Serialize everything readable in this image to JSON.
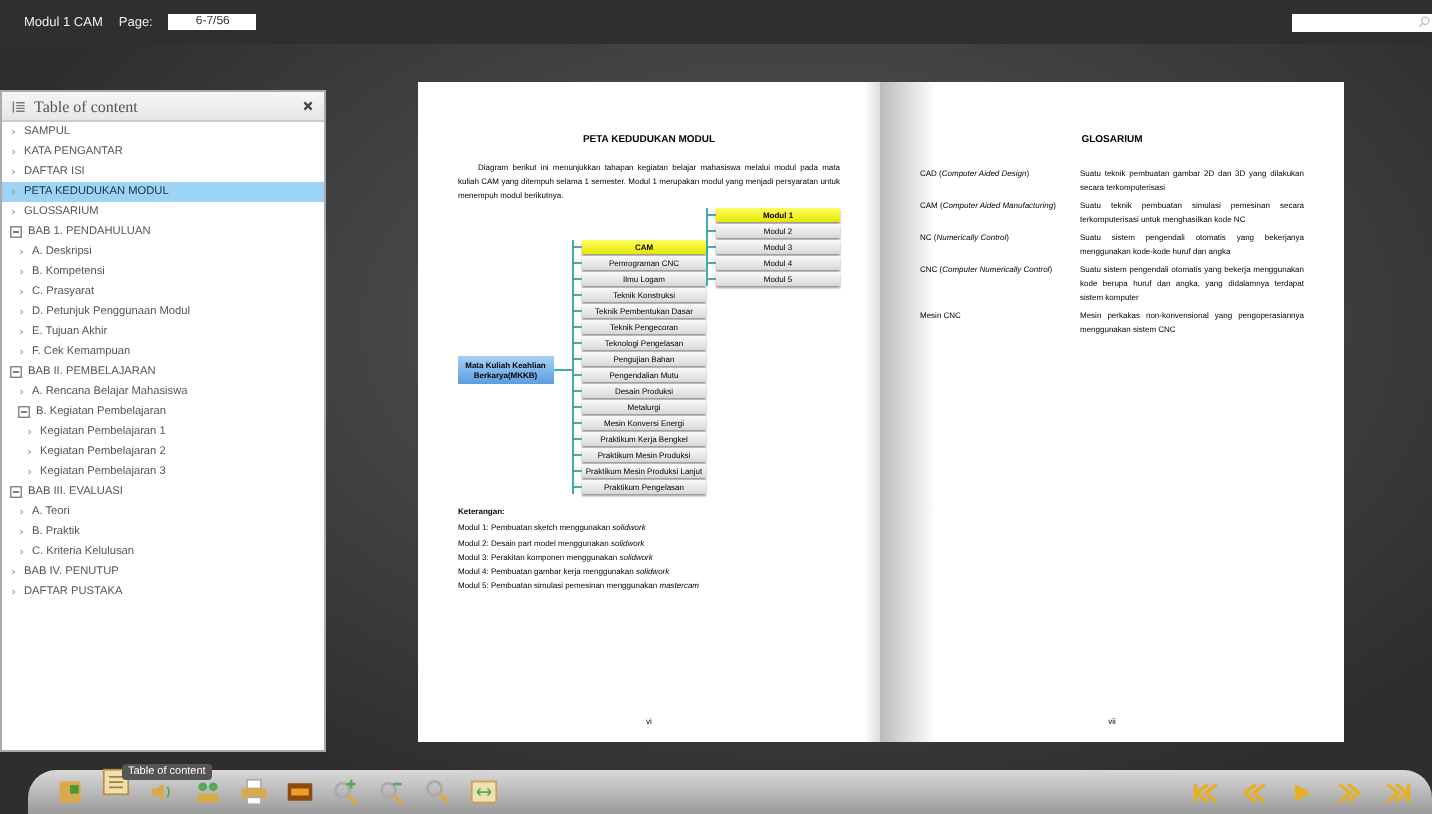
{
  "topbar": {
    "title": "Modul 1 CAM",
    "page_label": "Page:",
    "page_value": "6-7/56"
  },
  "toc": {
    "title": "Table of content",
    "items": [
      {
        "label": "SAMPUL",
        "selected": false
      },
      {
        "label": "KATA PENGANTAR",
        "selected": false
      },
      {
        "label": "DAFTAR ISI",
        "selected": false
      },
      {
        "label": "PETA KEDUDUKAN MODUL",
        "selected": true
      },
      {
        "label": "GLOSSARIUM",
        "selected": false
      },
      {
        "label": "BAB 1. PENDAHULUAN",
        "selected": false,
        "expanded": true,
        "children": [
          {
            "label": "A. Deskripsi",
            "selected": false
          },
          {
            "label": "B. Kompetensi",
            "selected": false
          },
          {
            "label": "C. Prasyarat",
            "selected": false
          },
          {
            "label": "D. Petunjuk Penggunaan Modul",
            "selected": false
          },
          {
            "label": "E. Tujuan Akhir",
            "selected": false
          },
          {
            "label": "F. Cek Kemampuan",
            "selected": false
          }
        ]
      },
      {
        "label": "BAB II. PEMBELAJARAN",
        "selected": false,
        "expanded": true,
        "children": [
          {
            "label": "A. Rencana Belajar Mahasiswa",
            "selected": false
          },
          {
            "label": "B. Kegiatan Pembelajaran",
            "selected": false,
            "expanded": true,
            "children": [
              {
                "label": "Kegiatan Pembelajaran 1",
                "selected": false
              },
              {
                "label": "Kegiatan Pembelajaran 2",
                "selected": false
              },
              {
                "label": "Kegiatan Pembelajaran 3",
                "selected": false
              }
            ]
          }
        ]
      },
      {
        "label": "BAB III. EVALUASI",
        "selected": false,
        "expanded": true,
        "children": [
          {
            "label": "A. Teori",
            "selected": false
          },
          {
            "label": "B. Praktik",
            "selected": false
          },
          {
            "label": "C. Kriteria Kelulusan",
            "selected": false
          }
        ]
      },
      {
        "label": "BAB IV. PENUTUP",
        "selected": false
      },
      {
        "label": "DAFTAR PUSTAKA",
        "selected": false
      }
    ]
  },
  "left_page": {
    "heading": "PETA KEDUDUKAN MODUL",
    "paragraph": "Diagram berikut ini menunjukkan tahapan kegiatan belajar mahasiswa melalui modul pada mata kuliah CAM yang ditempuh selama 1 semester. Modul 1 merupakan modul yang menjadi persyaratan untuk menempuh modul berikutnya.",
    "diagram": {
      "root": "Mata Kuliah Keahlian Berkarya(MKKB)",
      "courses": [
        {
          "label": "CAM",
          "highlighted": true
        },
        {
          "label": "Pemrograman CNC",
          "highlighted": false
        },
        {
          "label": "Ilmu Logam",
          "highlighted": false
        },
        {
          "label": "Teknik Konstruksi",
          "highlighted": false
        },
        {
          "label": "Teknik Pembentukan Dasar",
          "highlighted": false
        },
        {
          "label": "Teknik Pengecoran",
          "highlighted": false
        },
        {
          "label": "Teknologi Pengelasan",
          "highlighted": false
        },
        {
          "label": "Pengujian Bahan",
          "highlighted": false
        },
        {
          "label": "Pengendalian Mutu",
          "highlighted": false
        },
        {
          "label": "Desain Produksi",
          "highlighted": false
        },
        {
          "label": "Metalurgi",
          "highlighted": false
        },
        {
          "label": "Mesin Konversi Energi",
          "highlighted": false
        },
        {
          "label": "Praktikum Kerja Bengkel",
          "highlighted": false
        },
        {
          "label": "Praktikum Mesin Produksi",
          "highlighted": false
        },
        {
          "label": "Praktikum Mesin Produksi Lanjut",
          "highlighted": false
        },
        {
          "label": "Praktikum Pengelasan",
          "highlighted": false
        }
      ],
      "modules": [
        {
          "label": "Modul 1",
          "highlighted": true
        },
        {
          "label": "Modul 2",
          "highlighted": false
        },
        {
          "label": "Modul 3",
          "highlighted": false
        },
        {
          "label": "Modul 4",
          "highlighted": false
        },
        {
          "label": "Modul 5",
          "highlighted": false
        }
      ]
    },
    "notes_title": "Keterangan:",
    "notes": [
      "Modul 1: Pembuatan sketch menggunakan *solidwork*",
      "Modul 2: Desain part model menggunakan *solidwork*",
      "Modul 3: Perakitan komponen menggunakan *solidwork*",
      "Modul 4: Pembuatan gambar kerja menggunakan *solidwork*",
      "Modul 5: Pembuatan simulasi pemesinan menggunakan *mastercam*"
    ],
    "page_number": "vi"
  },
  "right_page": {
    "heading": "GLOSARIUM",
    "entries": [
      {
        "term": "CAD (*Computer Aided Design*)",
        "definition": "Suatu teknik pembuatan gambar 2D dan 3D yang dilakukan secara terkomputerisasi"
      },
      {
        "term": "CAM (*Computer Aided Manufacturing*)",
        "definition": "Suatu teknik pembuatan simulasi pemesinan secara terkomputerisasi untuk menghasilkan kode NC"
      },
      {
        "term": "NC (*Numerically Control*)",
        "definition": "Suatu sistem pengendali otomatis yang bekerjanya menggunakan kode-kode huruf dan angka"
      },
      {
        "term": "CNC (*Computer Numerically Control*)",
        "definition": "Suatu sistem pengendali otomatis yang bekerja menggunakan kode berupa huruf dan angka, yang didalamnya terdapat sistem komputer"
      },
      {
        "term": "Mesin CNC",
        "definition": "Mesin perkakas non-konvensional yang pengoperasiannya menggunakan sistem CNC"
      }
    ],
    "page_number": "vii"
  },
  "toolbar": {
    "tools": [
      {
        "kind": "thumbnails",
        "selected": false
      },
      {
        "kind": "toc",
        "selected": true
      },
      {
        "kind": "sound",
        "selected": false
      },
      {
        "kind": "share",
        "selected": false
      },
      {
        "kind": "print",
        "selected": false
      },
      {
        "kind": "image",
        "selected": false
      },
      {
        "kind": "zoomin",
        "selected": false
      },
      {
        "kind": "zoomout",
        "selected": false
      },
      {
        "kind": "search",
        "selected": false
      },
      {
        "kind": "fit",
        "selected": false
      }
    ],
    "tooltip": "Table of content",
    "nav": [
      {
        "kind": "first"
      },
      {
        "kind": "prev"
      },
      {
        "kind": "play"
      },
      {
        "kind": "next"
      },
      {
        "kind": "last"
      }
    ]
  }
}
